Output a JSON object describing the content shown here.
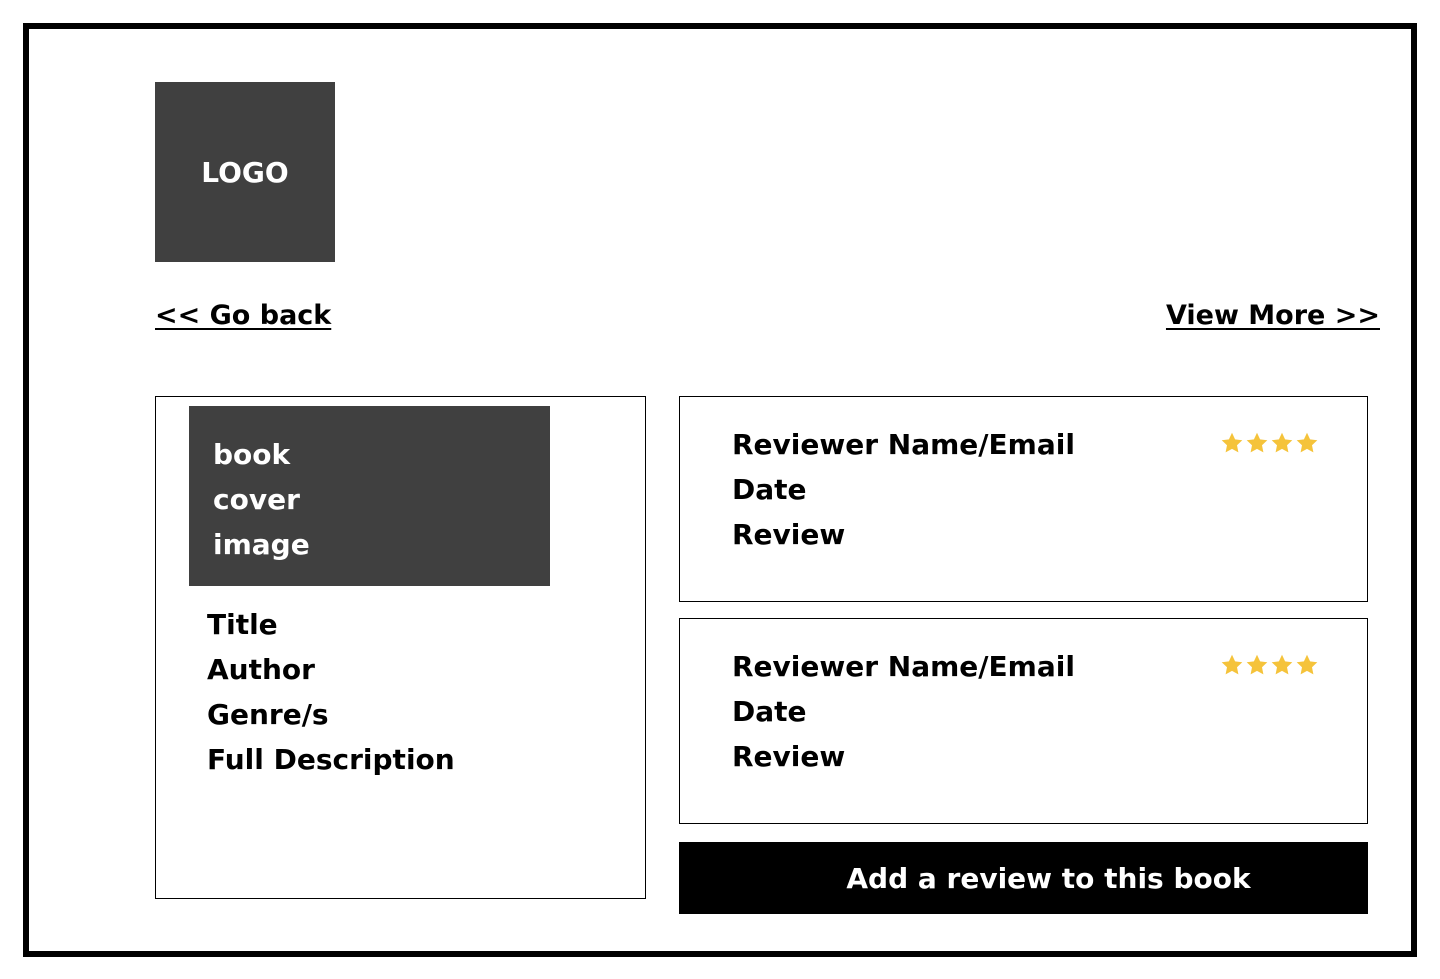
{
  "header": {
    "logo_text": "LOGO"
  },
  "nav": {
    "go_back_label": "<< Go back",
    "view_more_label": "View More >>"
  },
  "book": {
    "cover_lines": [
      "book",
      "cover",
      "image"
    ],
    "title_label": "Title",
    "author_label": "Author",
    "genre_label": "Genre/s",
    "description_label": "Full Description"
  },
  "reviews": [
    {
      "reviewer_label": "Reviewer Name/Email",
      "date_label": "Date",
      "review_label": "Review",
      "rating": 4,
      "star_icon": "star-icon"
    },
    {
      "reviewer_label": "Reviewer Name/Email",
      "date_label": "Date",
      "review_label": "Review",
      "rating": 4,
      "star_icon": "star-icon"
    }
  ],
  "actions": {
    "add_review_label": "Add a review to this book"
  },
  "colors": {
    "placeholder_fill": "#404040",
    "star_color": "#F5C33B",
    "button_bg": "#000000",
    "button_text": "#FFFFFF"
  }
}
